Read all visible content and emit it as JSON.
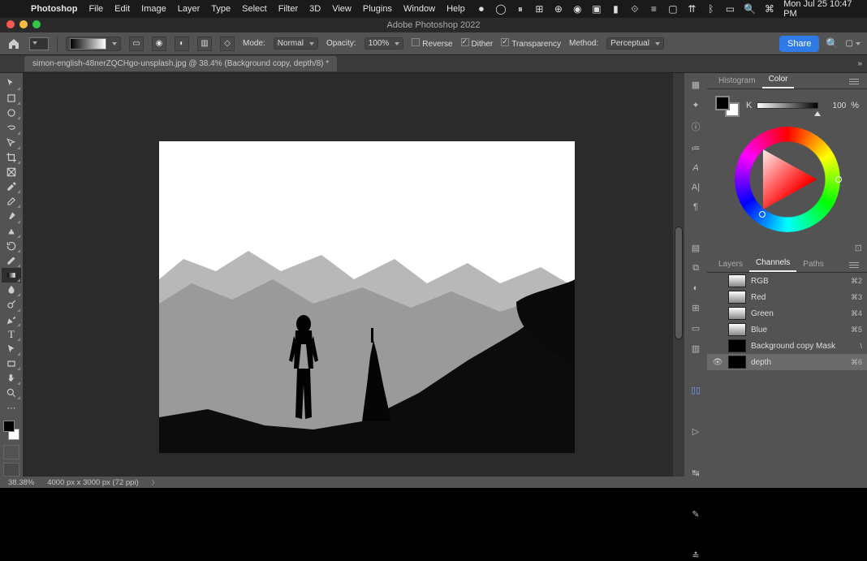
{
  "mac_menu": {
    "apple": "",
    "app": "Photoshop",
    "items": [
      "File",
      "Edit",
      "Image",
      "Layer",
      "Type",
      "Select",
      "Filter",
      "3D",
      "View",
      "Plugins",
      "Window",
      "Help"
    ],
    "clock": "Mon Jul 25  10:47 PM",
    "status_icons": [
      "record-icon",
      "circle-icon",
      "pause-icon",
      "grid-icon",
      "globe-icon",
      "camera-icon",
      "window-icon",
      "bookmark-icon",
      "cast-icon",
      "bars-icon",
      "tv-icon",
      "wifi-icon",
      "bluetooth-icon",
      "battery-icon",
      "spotlight-icon",
      "control-center-icon"
    ]
  },
  "title": "Adobe Photoshop 2022",
  "options_bar": {
    "gradient_types": [
      "linear",
      "radial",
      "angle",
      "reflected",
      "diamond"
    ],
    "mode_label": "Mode:",
    "mode_value": "Normal",
    "opacity_label": "Opacity:",
    "opacity_value": "100%",
    "reverse_label": "Reverse",
    "reverse_checked": false,
    "dither_label": "Dither",
    "dither_checked": true,
    "transparency_label": "Transparency",
    "transparency_checked": true,
    "method_label": "Method:",
    "method_value": "Perceptual",
    "share": "Share"
  },
  "doc_tab": {
    "label": "simon-english-48nerZQCHgo-unsplash.jpg @ 38.4% (Background copy, depth/8) *"
  },
  "left_tools": [
    "move-tool",
    "artboard-tool",
    "marquee-tool",
    "lasso-tool",
    "quick-select-tool",
    "crop-tool",
    "frame-tool",
    "eyedropper-tool",
    "healing-brush-tool",
    "brush-tool",
    "clone-stamp-tool",
    "history-brush-tool",
    "eraser-tool",
    "gradient-tool",
    "blur-tool",
    "dodge-tool",
    "pen-tool",
    "type-tool",
    "path-select-tool",
    "rectangle-tool",
    "hand-tool",
    "zoom-tool",
    "edit-toolbar"
  ],
  "panel_tabs_top": {
    "histogram": "Histogram",
    "color": "Color",
    "active": "color"
  },
  "color_panel": {
    "k_label": "K",
    "k_value": "100",
    "k_suffix": "%"
  },
  "panel_tabs_mid": {
    "layers": "Layers",
    "channels": "Channels",
    "paths": "Paths",
    "active": "channels"
  },
  "channels": [
    {
      "name": "RGB",
      "sc": "⌘2",
      "eye": false,
      "sel": false,
      "thumb": "rgb"
    },
    {
      "name": "Red",
      "sc": "⌘3",
      "eye": false,
      "sel": false,
      "thumb": "rgb"
    },
    {
      "name": "Green",
      "sc": "⌘4",
      "eye": false,
      "sel": false,
      "thumb": "rgb"
    },
    {
      "name": "Blue",
      "sc": "⌘5",
      "eye": false,
      "sel": false,
      "thumb": "rgb"
    },
    {
      "name": "Background copy Mask",
      "sc": "\\",
      "eye": false,
      "sel": false,
      "thumb": "mask"
    },
    {
      "name": "depth",
      "sc": "⌘6",
      "eye": true,
      "sel": true,
      "thumb": "mask"
    }
  ],
  "status": {
    "zoom": "38.38%",
    "dims": "4000 px x 3000 px (72 ppi)"
  },
  "dock_icons_top": [
    "swatches-icon",
    "brushes-icon",
    "info-icon",
    "properties-icon",
    "character-icon",
    "glyphs-icon",
    "paragraph-icon"
  ],
  "dock_icons_mid": [
    "libraries-icon",
    "clone-source-icon",
    "adjustments-icon",
    "styles-icon",
    "navigator-icon",
    "history-icon"
  ],
  "dock_icons_bot": [
    "actions-icon",
    "timeline-icon",
    "measure-icon",
    "comments-icon"
  ]
}
